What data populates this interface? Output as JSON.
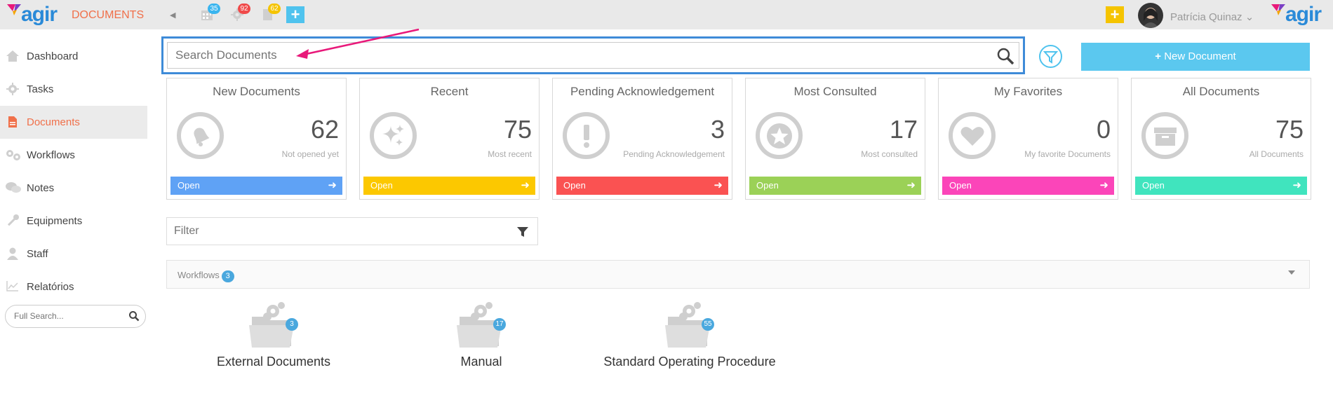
{
  "header": {
    "brand": "agir",
    "app_title": "DOCUMENTS",
    "collapse_icon": "chevron-left-icon",
    "notifications": [
      {
        "icon": "calendar-icon",
        "count": "35",
        "color": "#3ab5ef"
      },
      {
        "icon": "gear-icon",
        "count": "92",
        "color": "#f04a4a"
      },
      {
        "icon": "document-icon",
        "count": "62",
        "color": "#f5c400"
      }
    ],
    "add_color": "#4fc3ee",
    "quick_add_color": "#f5c400",
    "user_name": "Patrícia Quinaz",
    "brand_color": "#2a8ad8"
  },
  "sidebar": {
    "items": [
      {
        "label": "Dashboard",
        "icon": "home-icon"
      },
      {
        "label": "Tasks",
        "icon": "gear-icon"
      },
      {
        "label": "Documents",
        "icon": "document-icon"
      },
      {
        "label": "Workflows",
        "icon": "gears-icon"
      },
      {
        "label": "Notes",
        "icon": "comments-icon"
      },
      {
        "label": "Equipments",
        "icon": "wrench-icon"
      },
      {
        "label": "Staff",
        "icon": "user-icon"
      },
      {
        "label": "Relatórios",
        "icon": "chart-line-icon"
      }
    ],
    "active_index": 2,
    "full_search_placeholder": "Full Search..."
  },
  "search": {
    "placeholder": "Search Documents",
    "highlight_color": "#3e8bd8",
    "arrow_color": "#e8197a"
  },
  "new_document_label": "New Document",
  "cards": [
    {
      "title": "New Documents",
      "count": "62",
      "subtitle": "Not opened yet",
      "open_label": "Open",
      "color": "#5fa2f5",
      "icon": "bell-icon"
    },
    {
      "title": "Recent",
      "count": "75",
      "subtitle": "Most recent",
      "open_label": "Open",
      "color": "#fcc800",
      "icon": "sparkle-icon"
    },
    {
      "title": "Pending Acknowledgement",
      "count": "3",
      "subtitle": "Pending Acknowledgement",
      "open_label": "Open",
      "color": "#fa5252",
      "icon": "exclamation-icon"
    },
    {
      "title": "Most Consulted",
      "count": "17",
      "subtitle": "Most consulted",
      "open_label": "Open",
      "color": "#9bd157",
      "icon": "star-icon"
    },
    {
      "title": "My Favorites",
      "count": "0",
      "subtitle": "My favorite Documents",
      "open_label": "Open",
      "color": "#fb45b9",
      "icon": "heart-icon"
    },
    {
      "title": "All Documents",
      "count": "75",
      "subtitle": "All Documents",
      "open_label": "Open",
      "color": "#40e4be",
      "icon": "archive-icon"
    }
  ],
  "filter": {
    "placeholder": "Filter"
  },
  "workflows": {
    "label": "Workflows",
    "count": "3",
    "folders": [
      {
        "label": "External Documents",
        "count": "3"
      },
      {
        "label": "Manual",
        "count": "17"
      },
      {
        "label": "Standard Operating Procedure",
        "count": "55"
      }
    ]
  }
}
